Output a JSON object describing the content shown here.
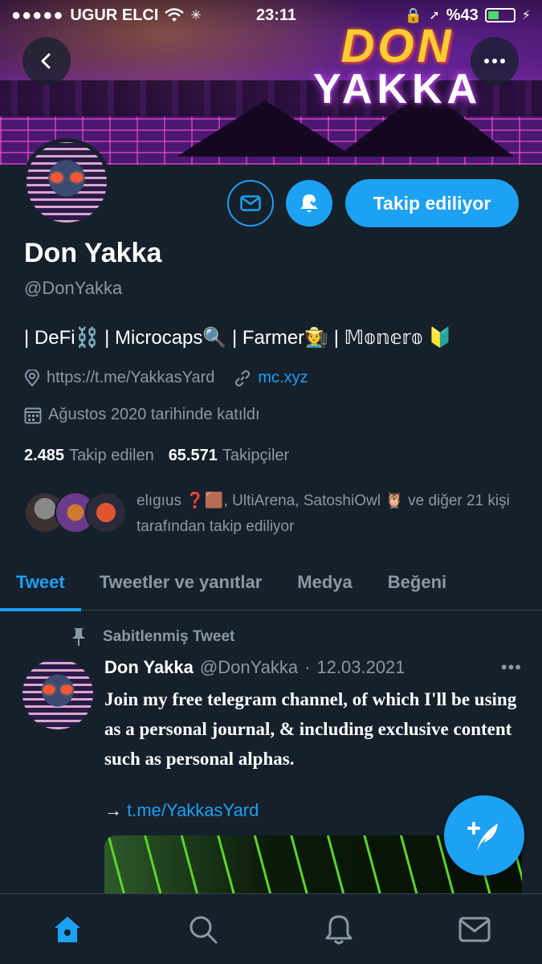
{
  "status_bar": {
    "carrier": "UGUR ELCI",
    "time": "23:11",
    "battery_text": "%43",
    "battery_level": 0.43
  },
  "banner": {
    "logo_line1": "DON",
    "logo_line2": "YAKKA"
  },
  "profile": {
    "name": "Don Yakka",
    "handle": "@DonYakka",
    "bio": "| DeFi⛓️ | Microcaps🔍 | Farmer🧑‍🌾 | 𝕄𝕠𝕟𝕖𝕣𝕠 🔰",
    "website_1": "https://t.me/YakkasYard",
    "website_2": "mc.xyz",
    "joined": "Ağustos 2020 tarihinde katıldı",
    "following_count": "2.485",
    "following_label": "Takip edilen",
    "followers_count": "65.571",
    "followers_label": "Takipçiler",
    "followed_by_text": "elıgıus ❓🟫, UltiArena, SatoshiOwl 🦉 ve diğer 21 kişi tarafından takip ediliyor"
  },
  "actions": {
    "follow_label": "Takip ediliyor"
  },
  "tabs": [
    {
      "label": "Tweet",
      "active": true
    },
    {
      "label": "Tweetler ve yanıtlar",
      "active": false
    },
    {
      "label": "Medya",
      "active": false
    },
    {
      "label": "Beğeni",
      "active": false
    }
  ],
  "pinned_tweet": {
    "pin_label": "Sabitlenmiş Tweet",
    "author_name": "Don Yakka",
    "author_handle": "@DonYakka",
    "separator": "·",
    "date": "12.03.2021",
    "text": "Join my free telegram channel, of which I'll be using as a personal journal, & including exclusive content such as personal alphas.",
    "link_arrow": "→",
    "link": "t.me/YakkasYard"
  },
  "colors": {
    "background": "#15202b",
    "accent": "#1da1f2",
    "muted_text": "#8899a6"
  }
}
